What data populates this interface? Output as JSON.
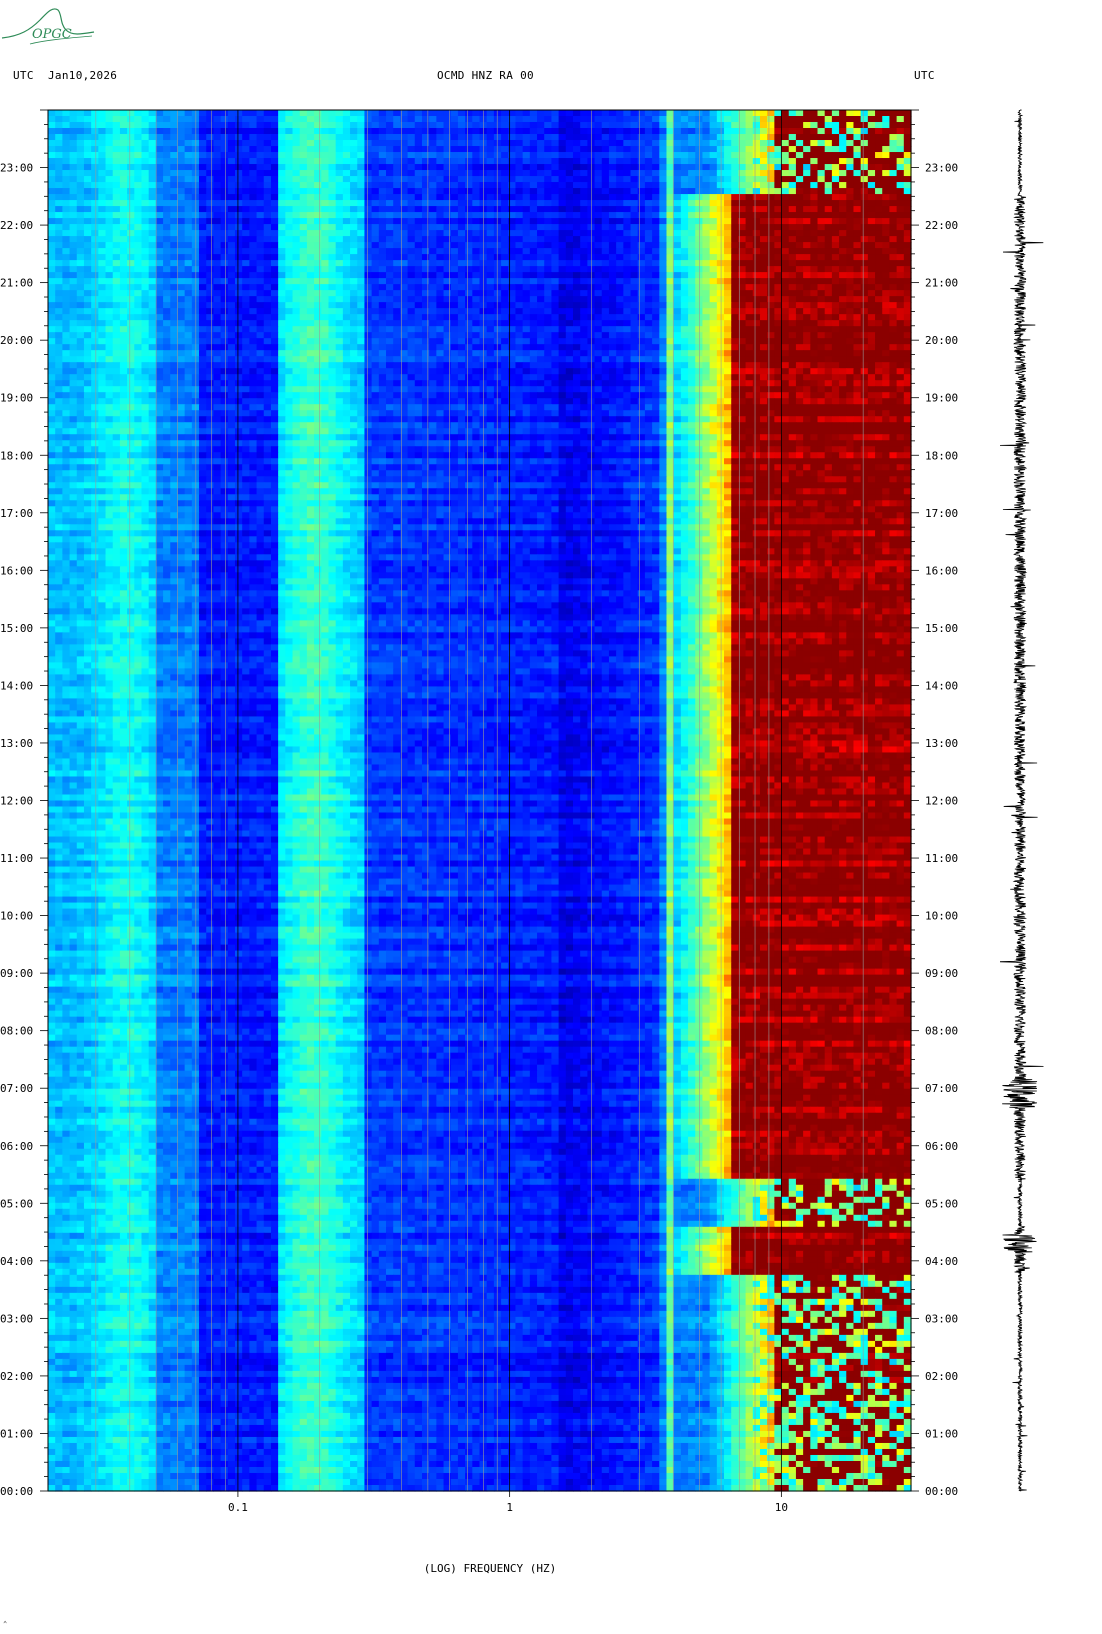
{
  "header": {
    "left_tz": "UTC",
    "date": "Jan10,2026",
    "station": "OCMD HNZ RA 00",
    "right_tz": "UTC"
  },
  "logo": {
    "text": "OPGC"
  },
  "colors": {
    "background": "#ffffff",
    "cold": "#0000a0",
    "hot": "#8b0000",
    "logo": "#2e8b57"
  },
  "chart_data": {
    "type": "heatmap",
    "title": "OCMD HNZ RA 00",
    "xlabel": "(LOG) FREQUENCY (HZ)",
    "x_scale": "log",
    "xlim": [
      0.02,
      30
    ],
    "x_ticks": [
      {
        "value": 0.1,
        "label": "0.1"
      },
      {
        "value": 1,
        "label": "1"
      },
      {
        "value": 10,
        "label": "10"
      }
    ],
    "ylabel": "UTC",
    "ylim_hours": [
      0,
      24
    ],
    "y_ticks": [
      "00:00",
      "01:00",
      "02:00",
      "03:00",
      "04:00",
      "05:00",
      "06:00",
      "07:00",
      "08:00",
      "09:00",
      "10:00",
      "11:00",
      "12:00",
      "13:00",
      "14:00",
      "15:00",
      "16:00",
      "17:00",
      "18:00",
      "19:00",
      "20:00",
      "21:00",
      "22:00",
      "23:00"
    ],
    "colorscale": [
      "#00008b",
      "#0000ff",
      "#0080ff",
      "#00ffff",
      "#80ff80",
      "#ffff00",
      "#ff8000",
      "#ff0000",
      "#8b0000"
    ],
    "features": [
      {
        "name": "microseism band",
        "freq_hz": [
          0.02,
          0.05
        ],
        "level": "cyan"
      },
      {
        "name": "secondary microseism",
        "freq_hz": [
          0.14,
          0.3
        ],
        "level": "cyan-yellow"
      },
      {
        "name": "narrow line",
        "freq_hz": 3.8,
        "level": "cyan"
      },
      {
        "name": "cultural noise onset",
        "freq_hz": 6,
        "level": "yellow-red"
      },
      {
        "name": "high-frequency noise",
        "freq_hz": [
          8,
          30
        ],
        "level": "dark red"
      }
    ],
    "quiet_intervals_hours": [
      [
        0,
        3.8
      ],
      [
        4.6,
        5.4
      ],
      [
        22.5,
        24
      ]
    ],
    "seismogram": {
      "trace": "HNZ",
      "span_hours": [
        0,
        24
      ]
    }
  },
  "footer": {
    "mark": "⌃"
  }
}
